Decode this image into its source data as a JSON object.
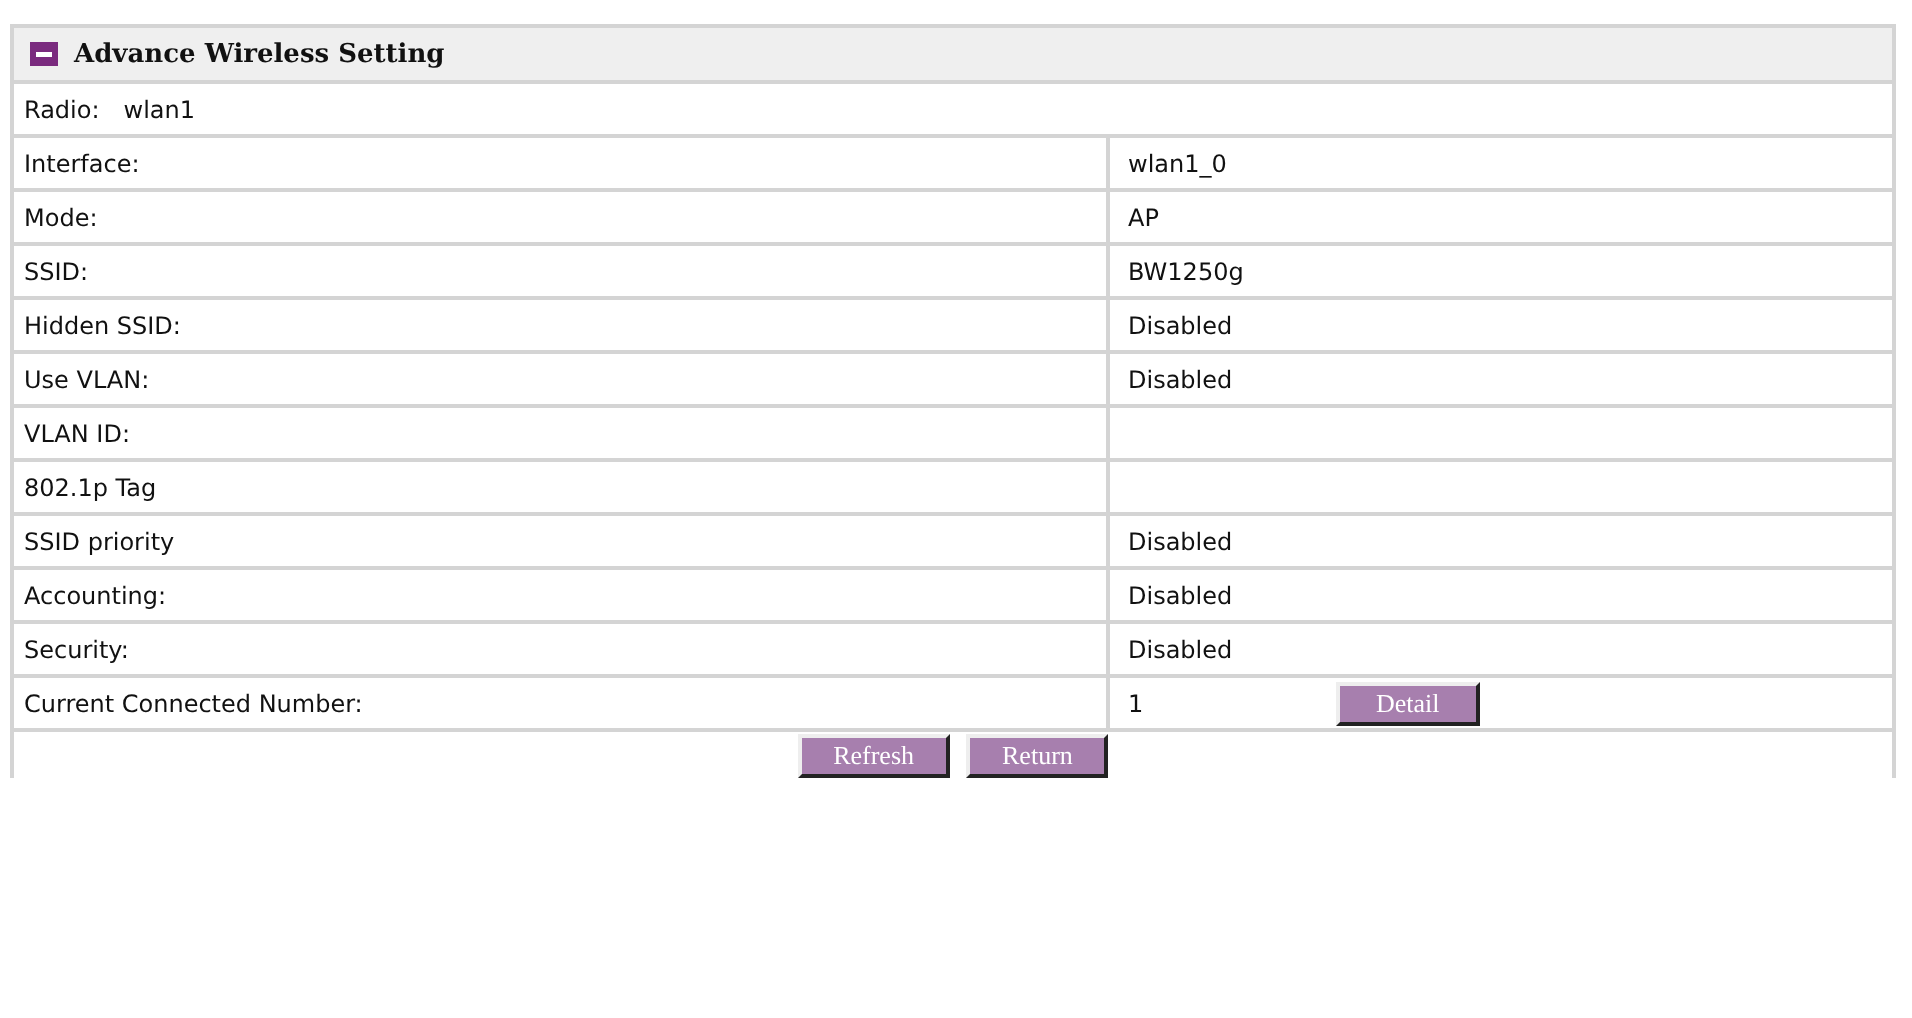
{
  "panel": {
    "title": "Advance Wireless Setting"
  },
  "radio": {
    "label": "Radio:",
    "value": "wlan1"
  },
  "rows": [
    {
      "label": "Interface:",
      "value": "wlan1_0"
    },
    {
      "label": "Mode:",
      "value": "AP"
    },
    {
      "label": "SSID:",
      "value": "BW1250g"
    },
    {
      "label": "Hidden SSID:",
      "value": "Disabled"
    },
    {
      "label": "Use VLAN:",
      "value": "Disabled"
    },
    {
      "label": "VLAN ID:",
      "value": ""
    },
    {
      "label": "802.1p Tag",
      "value": ""
    },
    {
      "label": "SSID priority",
      "value": "Disabled"
    },
    {
      "label": "Accounting:",
      "value": "Disabled"
    },
    {
      "label": "Security:",
      "value": "Disabled"
    },
    {
      "label": "Current Connected Number:",
      "value": "1",
      "button": "Detail"
    }
  ],
  "buttons": [
    "Refresh",
    "Return"
  ]
}
